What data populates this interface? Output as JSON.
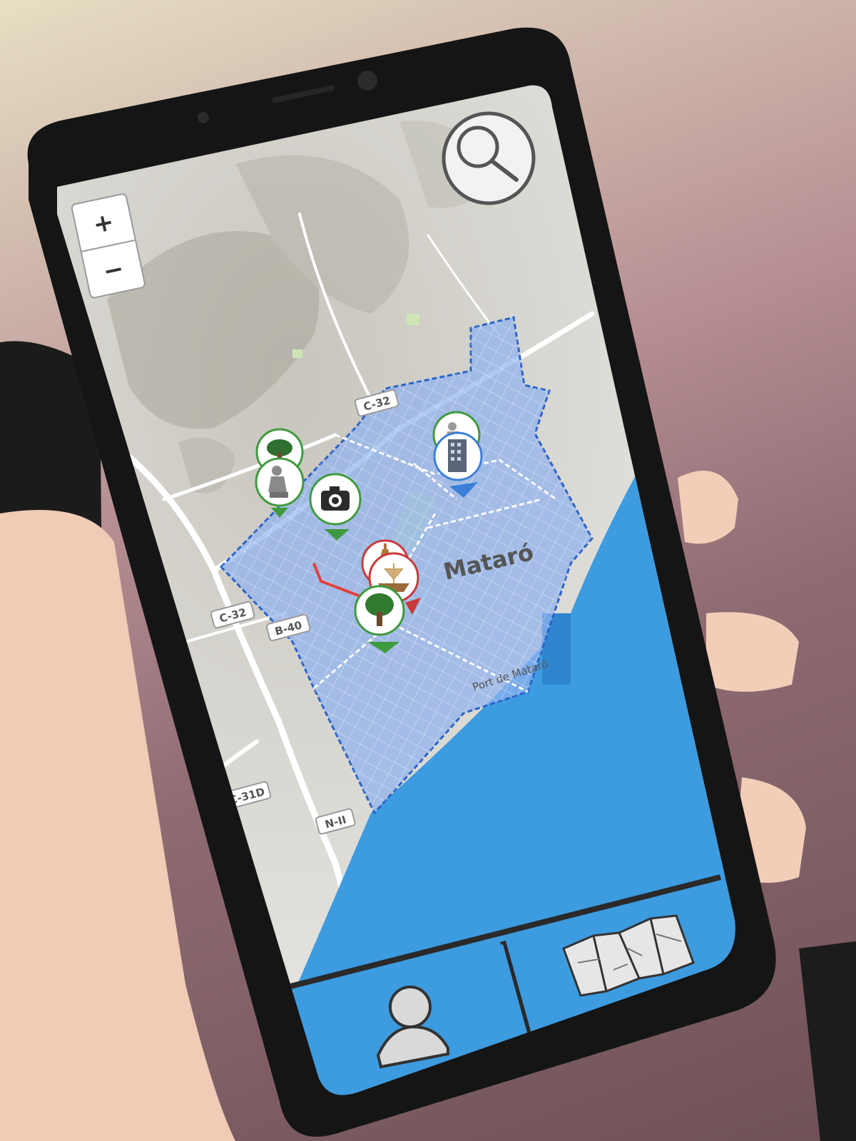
{
  "map": {
    "city_label": "Mataró",
    "port_label": "Port de Mataró",
    "road_labels": [
      {
        "id": "c32-north",
        "text": "C-32"
      },
      {
        "id": "c32-west",
        "text": "C-32"
      },
      {
        "id": "b40",
        "text": "B-40"
      },
      {
        "id": "c31d",
        "text": "C-31D"
      },
      {
        "id": "n2",
        "text": "N-II"
      }
    ]
  },
  "controls": {
    "zoom_in": "+",
    "zoom_out": "−",
    "search_icon": "search-icon"
  },
  "markers": [
    {
      "id": "park-north",
      "icon": "tree-icon",
      "color": "#3f9a3f"
    },
    {
      "id": "statue",
      "icon": "statue-icon",
      "color": "#3f9a3f"
    },
    {
      "id": "photo-spot",
      "icon": "camera-icon",
      "color": "#3f9a3f"
    },
    {
      "id": "monument-east",
      "icon": "statue-icon",
      "color": "#3f9a3f"
    },
    {
      "id": "building",
      "icon": "building-icon",
      "color": "#3a7fd8"
    },
    {
      "id": "church",
      "icon": "church-icon",
      "color": "#c83a3a"
    },
    {
      "id": "boat-museum",
      "icon": "boat-icon",
      "color": "#c83a3a"
    },
    {
      "id": "tree-park",
      "icon": "tree-icon",
      "color": "#3f9a3f"
    }
  ],
  "bottom_bar": {
    "profile_icon": "profile-icon",
    "map_icon": "folded-map-icon"
  },
  "colors": {
    "sea": "#3d9be0",
    "zone_fill": "#8fb1ee",
    "zone_stroke": "#2a63c9",
    "bottom_bar": "#3d9be0"
  }
}
